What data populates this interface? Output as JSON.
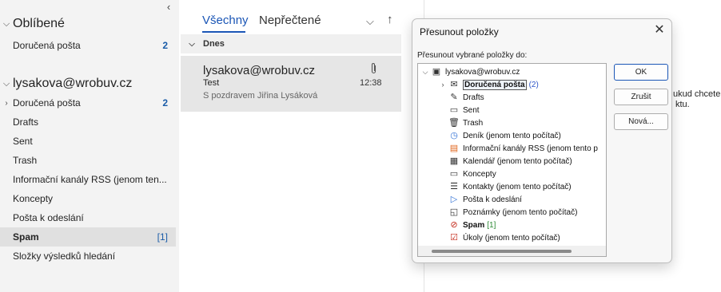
{
  "nav": {
    "collapse_icon": "chevron-left-icon"
  },
  "favorites": {
    "header": "Oblíbené",
    "items": [
      {
        "label": "Doručená pošta",
        "count": "2"
      }
    ]
  },
  "account": {
    "header": "lysakova@wrobuv.cz",
    "folders": [
      {
        "label": "Doručená pošta",
        "count": "2"
      },
      {
        "label": "Drafts"
      },
      {
        "label": "Sent"
      },
      {
        "label": "Trash"
      },
      {
        "label": "Informační kanály RSS (jenom ten..."
      },
      {
        "label": "Koncepty"
      },
      {
        "label": "Pošta k odeslání"
      },
      {
        "label": "Spam",
        "count": "[1]"
      },
      {
        "label": "Složky výsledků hledání"
      }
    ]
  },
  "list": {
    "tabs": [
      "Všechny",
      "Nepřečtené"
    ],
    "group": "Dnes",
    "message": {
      "sender": "lysakova@wrobuv.cz",
      "subject": "Test",
      "preview": "S pozdravem  Jiřina Lysáková",
      "time": "12:38"
    }
  },
  "reading": {
    "line1": "ukud chcete t",
    "line2": "ktu."
  },
  "dialog": {
    "title": "Přesunout položky",
    "prompt": "Přesunout vybrané položky do:",
    "tree": [
      {
        "label": "lysakova@wrobuv.cz",
        "icon": "mailbox-icon"
      },
      {
        "label": "Doručená pošta",
        "count": "(2)",
        "icon": "inbox-icon"
      },
      {
        "label": "Drafts",
        "icon": "drafts-icon"
      },
      {
        "label": "Sent",
        "icon": "sent-icon"
      },
      {
        "label": "Trash",
        "icon": "trash-icon"
      },
      {
        "label": "Deník (jenom tento počítač)",
        "icon": "journal-icon"
      },
      {
        "label": "Informační kanály RSS (jenom tento p",
        "icon": "rss-icon"
      },
      {
        "label": "Kalendář (jenom tento počítač)",
        "icon": "calendar-icon"
      },
      {
        "label": "Koncepty",
        "icon": "folder-icon"
      },
      {
        "label": "Kontakty (jenom tento počítač)",
        "icon": "contacts-icon"
      },
      {
        "label": "Pošta k odeslání",
        "icon": "outbox-icon"
      },
      {
        "label": "Poznámky (jenom tento počítač)",
        "icon": "notes-icon"
      },
      {
        "label": "Spam",
        "count": "[1]",
        "icon": "spam-icon"
      },
      {
        "label": "Úkoly (jenom tento počítač)",
        "icon": "tasks-icon"
      }
    ],
    "buttons": {
      "ok": "OK",
      "cancel": "Zrušit",
      "new": "Nová..."
    }
  }
}
